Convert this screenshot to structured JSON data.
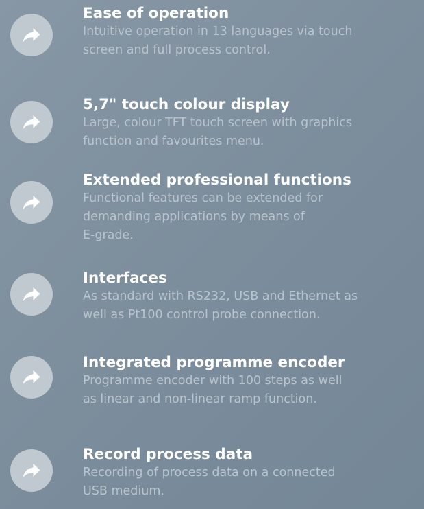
{
  "features": [
    {
      "title": "Ease of operation",
      "lines": [
        "Intuitive operation in 13 languages via touch",
        "screen and full process control."
      ],
      "icon": "share-arrow-icon"
    },
    {
      "title": "5,7\" touch colour display",
      "lines": [
        "Large, colour TFT touch screen with graphics",
        "function and favourites menu."
      ],
      "icon": "share-arrow-icon"
    },
    {
      "title": "Extended professional functions",
      "lines": [
        "Functional features can be extended for",
        "demanding applications by means of",
        "E-grade."
      ],
      "icon": "share-arrow-icon"
    },
    {
      "title": "Interfaces",
      "lines": [
        "As standard with RS232, USB and Ethernet as",
        "well as Pt100 control probe connection."
      ],
      "icon": "share-arrow-icon"
    },
    {
      "title": "Integrated programme encoder",
      "lines": [
        "Programme encoder with 100 steps as well",
        "as linear and non-linear ramp function."
      ],
      "icon": "share-arrow-icon"
    },
    {
      "title": "Record process data",
      "lines": [
        "Recording of process data on a connected",
        "USB medium."
      ],
      "icon": "share-arrow-icon"
    }
  ],
  "colors": {
    "background": "#7e8f9e",
    "title": "#ffffff",
    "description": "#b9c4cd",
    "icon_circle": "#c1c9d0",
    "icon_arrow": "#ffffff"
  }
}
